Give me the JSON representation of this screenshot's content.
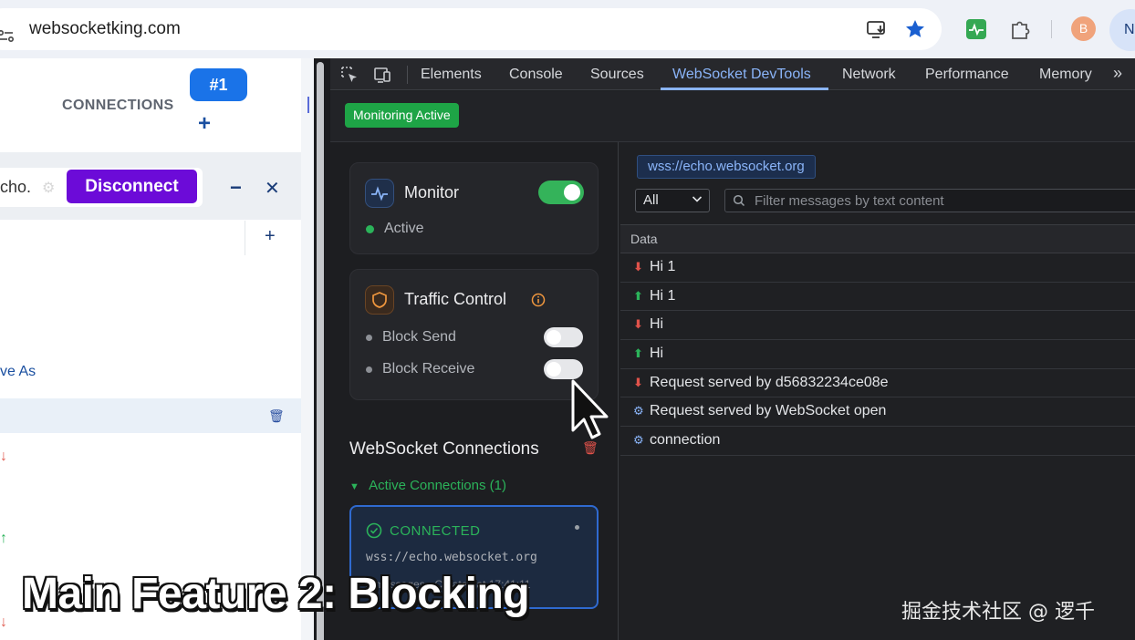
{
  "browser": {
    "url": "websocketking.com",
    "profile_initial": "B",
    "profile2_initial": "N"
  },
  "app": {
    "connections_label": "CONNECTIONS",
    "tab_label": "#1",
    "add_label": "+",
    "echo_text": "cho.",
    "disconnect_label": "Disconnect",
    "minimize_label": "−",
    "close_label": "✕",
    "save_as_label": "ve As"
  },
  "devtools": {
    "tabs": [
      "Elements",
      "Console",
      "Sources",
      "WebSocket DevTools",
      "Network",
      "Performance",
      "Memory"
    ],
    "active_tab": "WebSocket DevTools",
    "monitoring_badge": "Monitoring Active",
    "monitor": {
      "title": "Monitor",
      "status": "Active",
      "enabled": true
    },
    "traffic": {
      "title": "Traffic Control",
      "block_send_label": "Block Send",
      "block_receive_label": "Block Receive",
      "block_send": false,
      "block_receive": false
    },
    "connections": {
      "title": "WebSocket Connections",
      "active_label": "Active Connections (1)",
      "card": {
        "status": "CONNECTED",
        "url": "wss://echo.websocket.org",
        "meta": "5 messages · Created at 17:41:11"
      }
    },
    "messages": {
      "url_chip": "wss://echo.websocket.org",
      "filter_value": "All",
      "filter_placeholder": "Filter messages by text content",
      "column_header": "Data",
      "rows": [
        {
          "direction": "received",
          "text": "Hi 1"
        },
        {
          "direction": "sent",
          "text": "Hi 1"
        },
        {
          "direction": "received",
          "text": "Hi"
        },
        {
          "direction": "sent",
          "text": "Hi"
        },
        {
          "direction": "received",
          "text": "Request served by d56832234ce08e"
        },
        {
          "direction": "system",
          "text": "Request served by WebSocket open"
        },
        {
          "direction": "system",
          "text": "connection"
        }
      ]
    }
  },
  "overlay": {
    "caption": "Main Feature 2: Blocking",
    "watermark": "掘金技术社区 @ 逻千"
  },
  "colors": {
    "accent_blue": "#1a73e8",
    "disconnect_purple": "#6c0bd8",
    "success_green": "#1ea446",
    "received_red": "#e0524a",
    "sent_green": "#2bb35a",
    "system_blue": "#8ab4f8"
  }
}
